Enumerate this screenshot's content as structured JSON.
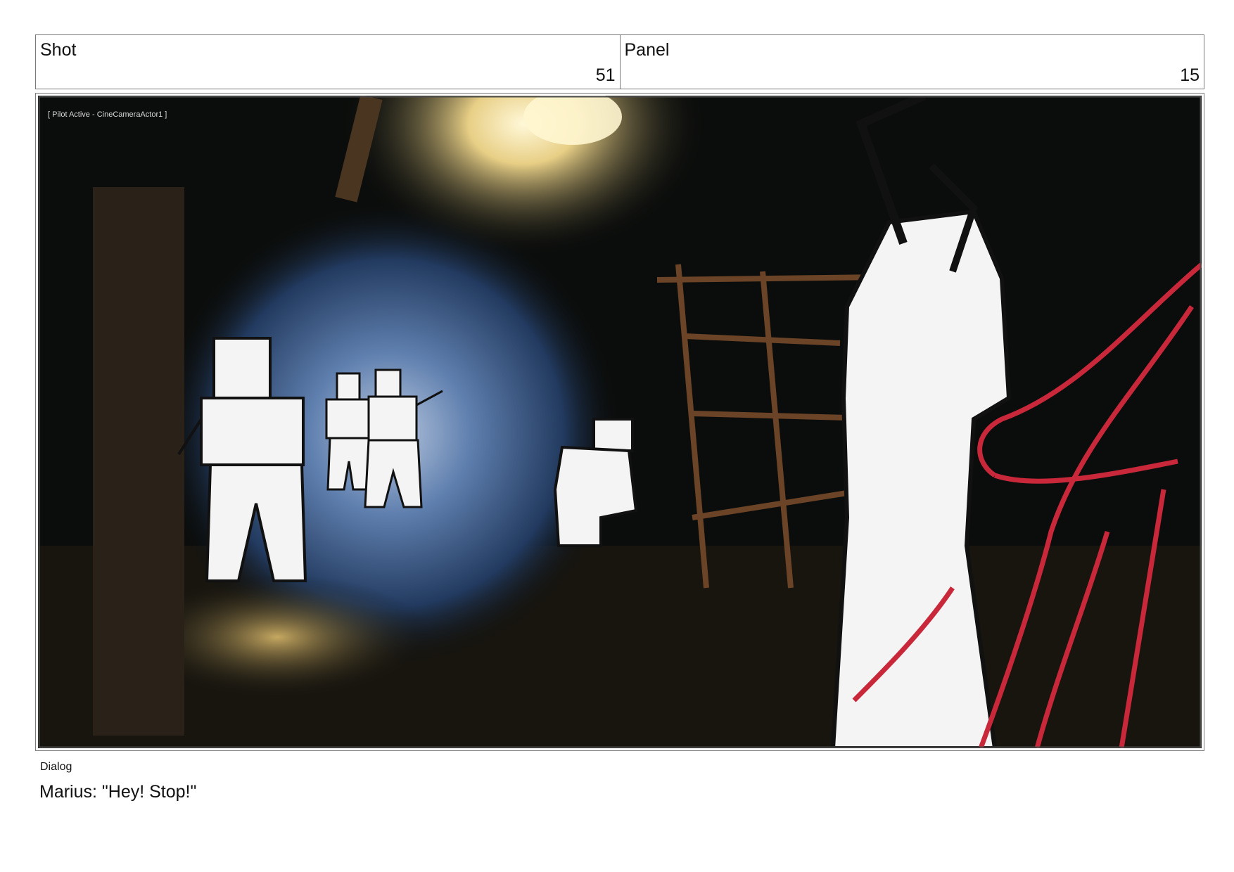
{
  "header": {
    "shot": {
      "label": "Shot",
      "value": "51"
    },
    "panel": {
      "label": "Panel",
      "value": "15"
    }
  },
  "frame": {
    "overlay_text": "[ Pilot Active - CineCameraActor1 ]",
    "palette": {
      "background": "#0b0d0c",
      "tunnel_blue": "#3a5d8f",
      "lamp_glow": "#f3e6b3",
      "sketch_red": "#c8283a",
      "sketch_white": "#f4f4f4"
    }
  },
  "dialog": {
    "label": "Dialog",
    "text": "Marius: \"Hey! Stop!\""
  }
}
